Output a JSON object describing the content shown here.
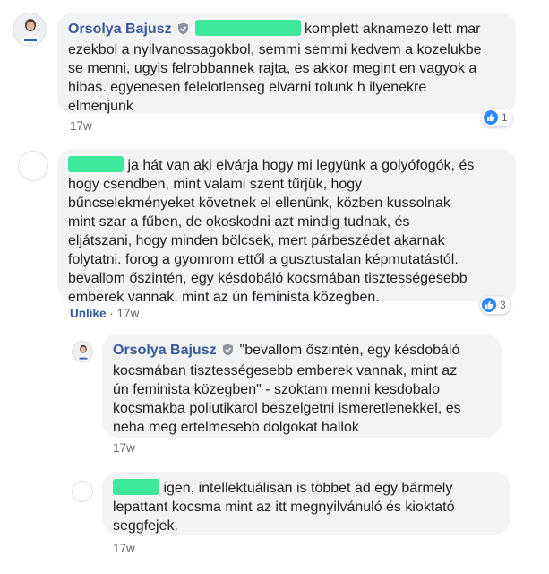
{
  "colors": {
    "link": "#385898",
    "bubble": "#f2f3f5",
    "reaction": "#2e89ff",
    "redaction": "#3ee89a"
  },
  "comments": [
    {
      "author": "Orsolya Bajusz",
      "badge_icon": "shield-badge-icon",
      "lines": [
        "komplett aknamezo lett mar",
        "ezekbol a nyilvanossagokbol, semmi semmi kedvem a kozelukbe",
        "se menni, ugyis felrobbannek rajta, es akkor megint en vagyok a",
        "hibas. egyenesen felelotlenseg elvarni tolunk h ilyenekre",
        "elmenjunk"
      ],
      "time": "17w",
      "reactions": "1"
    },
    {
      "lines": [
        "ja hát van aki elvárja hogy mi legyünk a golyófogók, és",
        "hogy csendben, mint valami szent tűrjük, hogy",
        "bűncselekményeket követnek el ellenünk, közben kussolnak",
        "mint szar a fűben, de okoskodni azt mindig tudnak, és",
        "eljátszani, hogy minden bölcsek, mert párbeszédet akarnak",
        "folytatni. forog a gyomrom ettől a gusztustalan képmutatástól.",
        "bevallom őszintén, egy késdobáló kocsmában tisztességesebb",
        "emberek vannak, mint az ún feminista közegben."
      ],
      "unlike": "Unlike",
      "separator": "·",
      "time": "17w",
      "reactions": "3"
    }
  ],
  "replies": [
    {
      "author": "Orsolya Bajusz",
      "badge_icon": "shield-badge-icon",
      "lines": [
        "\"bevallom őszintén, egy késdobáló",
        "kocsmában tisztességesebb emberek vannak, mint az",
        "ún feminista közegben\" - szoktam menni kesdobalo",
        "kocsmakba poliutikarol beszelgetni ismeretlenekkel, es",
        "neha meg ertelmesebb dolgokat hallok"
      ],
      "time": "17w"
    },
    {
      "lines": [
        "igen, intellektuálisan is többet ad egy bármely",
        "lepattant kocsma mint az itt megnyilvánuló és kioktató",
        "seggfejek."
      ],
      "time": "17w"
    }
  ]
}
